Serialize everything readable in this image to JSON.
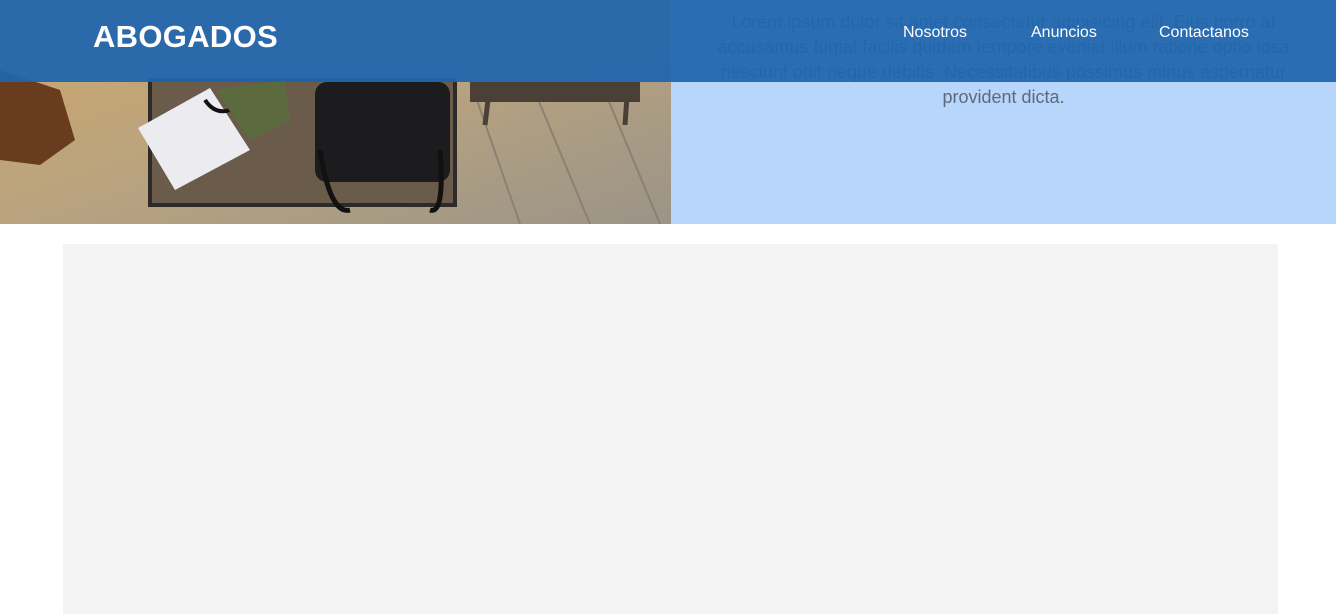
{
  "header": {
    "logo": "ABOGADOS",
    "nav": [
      "Nosotros",
      "Anuncios",
      "Contactanos"
    ]
  },
  "hero": {
    "text": "Lorem ipsum dolor sit amet consectetur adipisicing elit. Eius porro at accusamus fugiat facilis quidem tempore eveniet illum ratione optio ipsa nesciunt odit neque debitis. Necessitatibus possimus minus aspernatur provident dicta.",
    "photo": "office-table-photo"
  },
  "colors": {
    "navbar": "#2166ad",
    "hero_panel": "#b8d5fb",
    "content_box": "#f3f3f3"
  }
}
